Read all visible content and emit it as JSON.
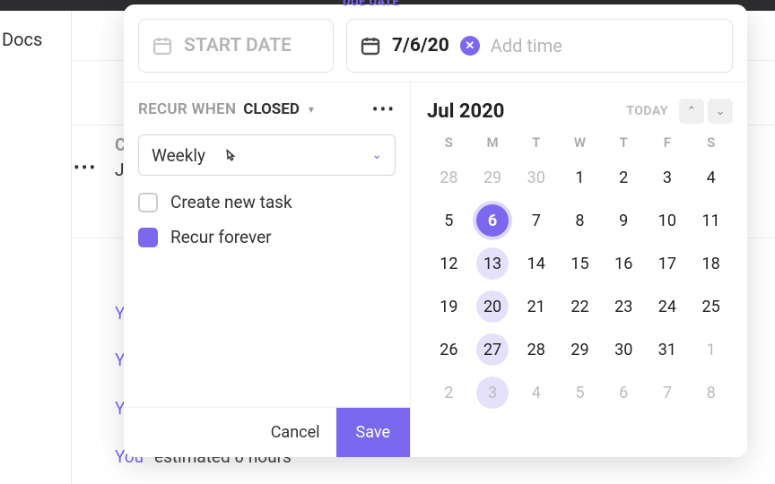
{
  "background": {
    "docs_label": "Docs",
    "plus_label": "+",
    "cr_label": "CR",
    "ju_label": "Ju",
    "you_links": [
      "Yo",
      "Yo",
      "Yo",
      "You"
    ],
    "estimated_text": "estimated 0 hours"
  },
  "date_picker": {
    "due_date_header": "DUE DATE",
    "start_placeholder": "START DATE",
    "due_value": "7/6/20",
    "add_time": "Add time"
  },
  "recur": {
    "label": "RECUR WHEN",
    "status": "CLOSED",
    "frequency": "Weekly",
    "create_new_task_label": "Create new task",
    "create_new_task_checked": false,
    "recur_forever_label": "Recur forever",
    "recur_forever_checked": true
  },
  "actions": {
    "cancel": "Cancel",
    "save": "Save"
  },
  "calendar": {
    "month_label": "Jul 2020",
    "today_label": "TODAY",
    "dow": [
      "S",
      "M",
      "T",
      "W",
      "T",
      "F",
      "S"
    ],
    "days": [
      {
        "n": 28,
        "other": true
      },
      {
        "n": 29,
        "other": true
      },
      {
        "n": 30,
        "other": true
      },
      {
        "n": 1
      },
      {
        "n": 2
      },
      {
        "n": 3
      },
      {
        "n": 4
      },
      {
        "n": 5
      },
      {
        "n": 6,
        "selected": true
      },
      {
        "n": 7
      },
      {
        "n": 8
      },
      {
        "n": 9
      },
      {
        "n": 10
      },
      {
        "n": 11
      },
      {
        "n": 12
      },
      {
        "n": 13,
        "highlight": true
      },
      {
        "n": 14
      },
      {
        "n": 15
      },
      {
        "n": 16
      },
      {
        "n": 17
      },
      {
        "n": 18
      },
      {
        "n": 19
      },
      {
        "n": 20,
        "highlight": true
      },
      {
        "n": 21
      },
      {
        "n": 22
      },
      {
        "n": 23
      },
      {
        "n": 24
      },
      {
        "n": 25
      },
      {
        "n": 26
      },
      {
        "n": 27,
        "highlight": true
      },
      {
        "n": 28
      },
      {
        "n": 29
      },
      {
        "n": 30
      },
      {
        "n": 31
      },
      {
        "n": 1,
        "other": true
      },
      {
        "n": 2,
        "other": true
      },
      {
        "n": 3,
        "highlight": true,
        "other": true
      },
      {
        "n": 4,
        "other": true
      },
      {
        "n": 5,
        "other": true
      },
      {
        "n": 6,
        "other": true
      },
      {
        "n": 7,
        "other": true
      },
      {
        "n": 8,
        "other": true
      }
    ]
  }
}
